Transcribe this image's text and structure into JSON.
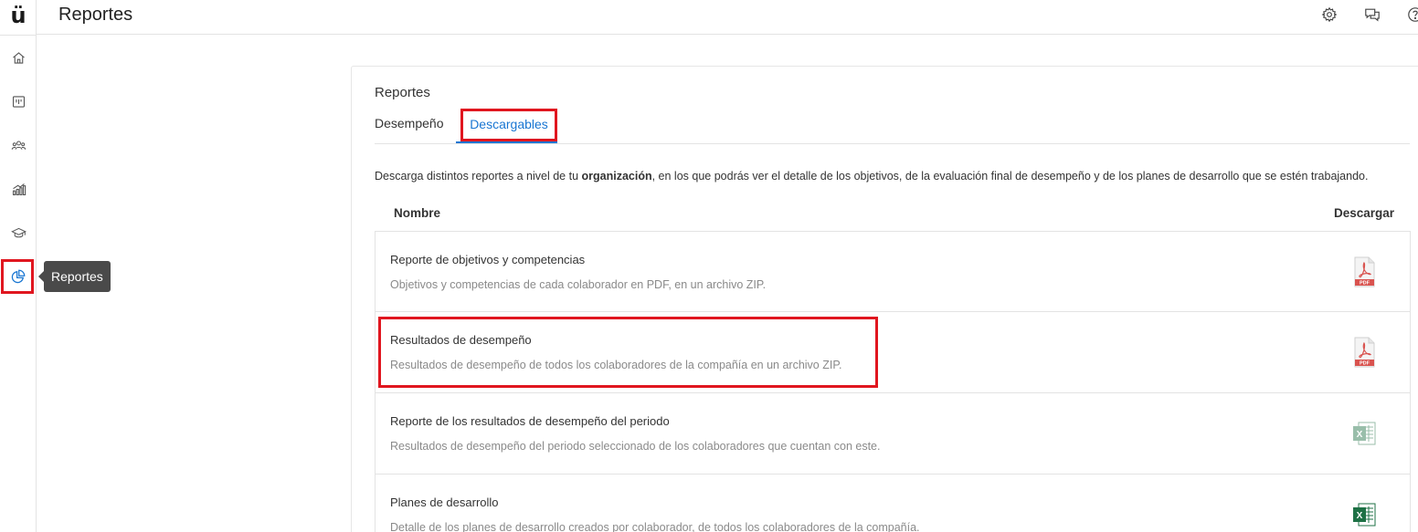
{
  "app": {
    "logo_text": "ü",
    "page_title": "Reportes",
    "tooltip": "Reportes"
  },
  "sidebar": {
    "items": [
      {
        "name": "home",
        "icon": "home-icon"
      },
      {
        "name": "board",
        "icon": "board-icon"
      },
      {
        "name": "people",
        "icon": "people-icon"
      },
      {
        "name": "analytics",
        "icon": "bar-chart-icon"
      },
      {
        "name": "learning",
        "icon": "graduation-cap-icon"
      },
      {
        "name": "reports",
        "icon": "pie-chart-icon",
        "active": true
      }
    ]
  },
  "topbar": {
    "icons": [
      "gear-icon",
      "chat-icon",
      "help-icon"
    ]
  },
  "card": {
    "title": "Reportes",
    "tabs": [
      {
        "label": "Desempeño"
      },
      {
        "label": "Descargables",
        "active": true
      }
    ],
    "description_before": "Descarga distintos reportes a nivel de tu ",
    "description_bold": "organización",
    "description_after": ", en los que podrás ver el detalle de los objetivos, de la evaluación final de desempeño y de los planes de desarrollo que se estén trabajando.",
    "columns": {
      "nombre": "Nombre",
      "descargar": "Descargar"
    },
    "rows": [
      {
        "title": "Reporte de objetivos y competencias",
        "desc": "Objetivos y competencias de cada colaborador en PDF, en un archivo ZIP.",
        "file_type": "PDF"
      },
      {
        "title": "Resultados de desempeño",
        "desc": "Resultados de desempeño de todos los colaboradores de la compañía en un archivo ZIP.",
        "file_type": "PDF"
      },
      {
        "title": "Reporte de los resultados de desempeño del periodo",
        "desc": "Resultados de desempeño del periodo seleccionado de los colaboradores que cuentan con este.",
        "file_type": "XLS"
      },
      {
        "title": "Planes de desarrollo",
        "desc": "Detalle de los planes de desarrollo creados por colaborador, de todos los colaboradores de la compañía.",
        "file_type": "XLS"
      }
    ]
  },
  "colors": {
    "accent": "#1976d2",
    "highlight": "#e0161f",
    "pdf_red": "#d9534f",
    "excel_green": "#1e7145"
  }
}
